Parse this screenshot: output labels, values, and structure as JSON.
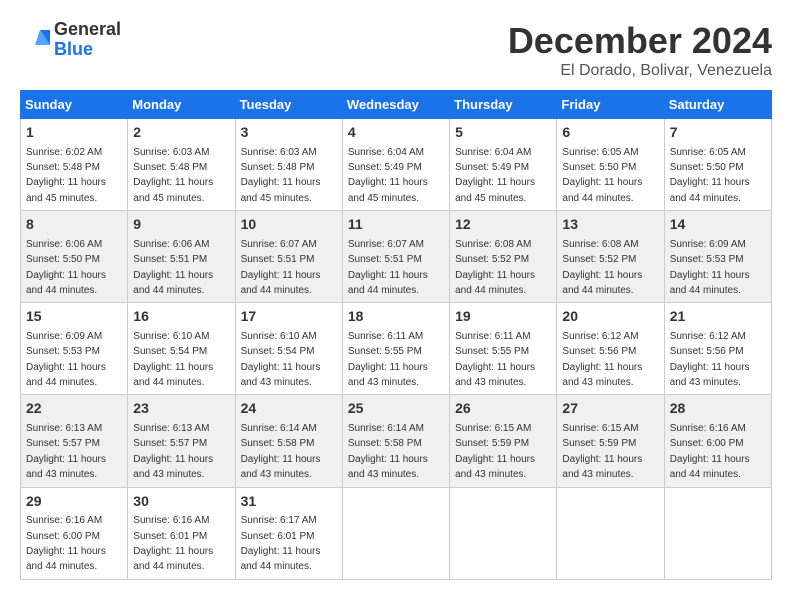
{
  "logo": {
    "general": "General",
    "blue": "Blue"
  },
  "title": "December 2024",
  "location": "El Dorado, Bolivar, Venezuela",
  "days_header": [
    "Sunday",
    "Monday",
    "Tuesday",
    "Wednesday",
    "Thursday",
    "Friday",
    "Saturday"
  ],
  "weeks": [
    [
      {
        "day": "1",
        "info": "Sunrise: 6:02 AM\nSunset: 5:48 PM\nDaylight: 11 hours\nand 45 minutes."
      },
      {
        "day": "2",
        "info": "Sunrise: 6:03 AM\nSunset: 5:48 PM\nDaylight: 11 hours\nand 45 minutes."
      },
      {
        "day": "3",
        "info": "Sunrise: 6:03 AM\nSunset: 5:48 PM\nDaylight: 11 hours\nand 45 minutes."
      },
      {
        "day": "4",
        "info": "Sunrise: 6:04 AM\nSunset: 5:49 PM\nDaylight: 11 hours\nand 45 minutes."
      },
      {
        "day": "5",
        "info": "Sunrise: 6:04 AM\nSunset: 5:49 PM\nDaylight: 11 hours\nand 45 minutes."
      },
      {
        "day": "6",
        "info": "Sunrise: 6:05 AM\nSunset: 5:50 PM\nDaylight: 11 hours\nand 44 minutes."
      },
      {
        "day": "7",
        "info": "Sunrise: 6:05 AM\nSunset: 5:50 PM\nDaylight: 11 hours\nand 44 minutes."
      }
    ],
    [
      {
        "day": "8",
        "info": "Sunrise: 6:06 AM\nSunset: 5:50 PM\nDaylight: 11 hours\nand 44 minutes."
      },
      {
        "day": "9",
        "info": "Sunrise: 6:06 AM\nSunset: 5:51 PM\nDaylight: 11 hours\nand 44 minutes."
      },
      {
        "day": "10",
        "info": "Sunrise: 6:07 AM\nSunset: 5:51 PM\nDaylight: 11 hours\nand 44 minutes."
      },
      {
        "day": "11",
        "info": "Sunrise: 6:07 AM\nSunset: 5:51 PM\nDaylight: 11 hours\nand 44 minutes."
      },
      {
        "day": "12",
        "info": "Sunrise: 6:08 AM\nSunset: 5:52 PM\nDaylight: 11 hours\nand 44 minutes."
      },
      {
        "day": "13",
        "info": "Sunrise: 6:08 AM\nSunset: 5:52 PM\nDaylight: 11 hours\nand 44 minutes."
      },
      {
        "day": "14",
        "info": "Sunrise: 6:09 AM\nSunset: 5:53 PM\nDaylight: 11 hours\nand 44 minutes."
      }
    ],
    [
      {
        "day": "15",
        "info": "Sunrise: 6:09 AM\nSunset: 5:53 PM\nDaylight: 11 hours\nand 44 minutes."
      },
      {
        "day": "16",
        "info": "Sunrise: 6:10 AM\nSunset: 5:54 PM\nDaylight: 11 hours\nand 44 minutes."
      },
      {
        "day": "17",
        "info": "Sunrise: 6:10 AM\nSunset: 5:54 PM\nDaylight: 11 hours\nand 43 minutes."
      },
      {
        "day": "18",
        "info": "Sunrise: 6:11 AM\nSunset: 5:55 PM\nDaylight: 11 hours\nand 43 minutes."
      },
      {
        "day": "19",
        "info": "Sunrise: 6:11 AM\nSunset: 5:55 PM\nDaylight: 11 hours\nand 43 minutes."
      },
      {
        "day": "20",
        "info": "Sunrise: 6:12 AM\nSunset: 5:56 PM\nDaylight: 11 hours\nand 43 minutes."
      },
      {
        "day": "21",
        "info": "Sunrise: 6:12 AM\nSunset: 5:56 PM\nDaylight: 11 hours\nand 43 minutes."
      }
    ],
    [
      {
        "day": "22",
        "info": "Sunrise: 6:13 AM\nSunset: 5:57 PM\nDaylight: 11 hours\nand 43 minutes."
      },
      {
        "day": "23",
        "info": "Sunrise: 6:13 AM\nSunset: 5:57 PM\nDaylight: 11 hours\nand 43 minutes."
      },
      {
        "day": "24",
        "info": "Sunrise: 6:14 AM\nSunset: 5:58 PM\nDaylight: 11 hours\nand 43 minutes."
      },
      {
        "day": "25",
        "info": "Sunrise: 6:14 AM\nSunset: 5:58 PM\nDaylight: 11 hours\nand 43 minutes."
      },
      {
        "day": "26",
        "info": "Sunrise: 6:15 AM\nSunset: 5:59 PM\nDaylight: 11 hours\nand 43 minutes."
      },
      {
        "day": "27",
        "info": "Sunrise: 6:15 AM\nSunset: 5:59 PM\nDaylight: 11 hours\nand 43 minutes."
      },
      {
        "day": "28",
        "info": "Sunrise: 6:16 AM\nSunset: 6:00 PM\nDaylight: 11 hours\nand 44 minutes."
      }
    ],
    [
      {
        "day": "29",
        "info": "Sunrise: 6:16 AM\nSunset: 6:00 PM\nDaylight: 11 hours\nand 44 minutes."
      },
      {
        "day": "30",
        "info": "Sunrise: 6:16 AM\nSunset: 6:01 PM\nDaylight: 11 hours\nand 44 minutes."
      },
      {
        "day": "31",
        "info": "Sunrise: 6:17 AM\nSunset: 6:01 PM\nDaylight: 11 hours\nand 44 minutes."
      },
      {
        "day": "",
        "info": ""
      },
      {
        "day": "",
        "info": ""
      },
      {
        "day": "",
        "info": ""
      },
      {
        "day": "",
        "info": ""
      }
    ]
  ]
}
